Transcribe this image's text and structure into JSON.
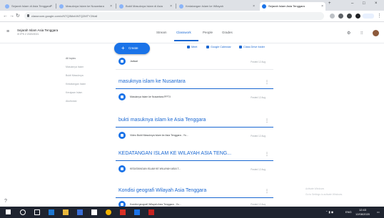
{
  "browser": {
    "tabs": [
      {
        "label": "Sejarah Islam di Asia Tenggara",
        "active": false
      },
      {
        "label": "Masuknya Islam ke Nusantara",
        "active": false
      },
      {
        "label": "Bukti Masuknya Islam di Asia",
        "active": false
      },
      {
        "label": "Kedatangan Islam ke Wilayah",
        "active": false
      },
      {
        "label": "Sejarah Islam Asia Tenggara",
        "active": true
      }
    ],
    "address": "classroom.google.com/c/NTQ3MzI4NTQ2MTY2/t/all",
    "accent_color": "#1a73e8"
  },
  "app": {
    "course_title": "Sejarah Islam Asia Tenggara",
    "course_subtitle": "XI IPS 2 2020/2021",
    "tabs": [
      {
        "label": "Stream",
        "selected": false
      },
      {
        "label": "Classwork",
        "selected": true
      },
      {
        "label": "People",
        "selected": false
      },
      {
        "label": "Grades",
        "selected": false
      }
    ]
  },
  "classwork": {
    "create_label": "Create",
    "create_icon": "plus-icon",
    "links": {
      "meet": "Meet",
      "calendar": "Google Calendar",
      "drive": "Class Drive folder"
    },
    "topics": [
      "All topics",
      "Masuknya Islam",
      "Bukti Masuknya",
      "Kedatangan Islam",
      "Kerajaan Islam",
      "Akulturasi"
    ],
    "first_item": {
      "title": "Jadwal",
      "date": "Posted 12 Aug"
    },
    "sections": [
      {
        "title": "masuknya islam ke Nusantara",
        "item": "Masuknya Islam ke Nusantara.PPTX",
        "date": "Posted 12 Aug"
      },
      {
        "title": "bukti masuknya islam ke Asia Tenggara",
        "item": "Video Bukti Masuknya Islam ke Asia Tenggara - Yo...",
        "date": "Posted 12 Aug"
      },
      {
        "title": "KEDATANGAN ISLAM KE WILAYAH ASIA TENG...",
        "item": "KEDATANGAN ISLAM KE WILAYAH ASIA T...",
        "date": "Posted 12 Aug"
      },
      {
        "title": "Kondisi geografi Wilayah Asia Tenggara",
        "item": "Kondisi geografi Wilayah Asia Tenggara - Yo...",
        "date": "Posted 12 Aug"
      }
    ],
    "side_note_line1": "Activate Windows",
    "side_note_line2": "Go to Settings to activate Windows."
  },
  "taskbar": {
    "time": "12:43",
    "date": "12/08/2020",
    "lang": "ENG"
  }
}
